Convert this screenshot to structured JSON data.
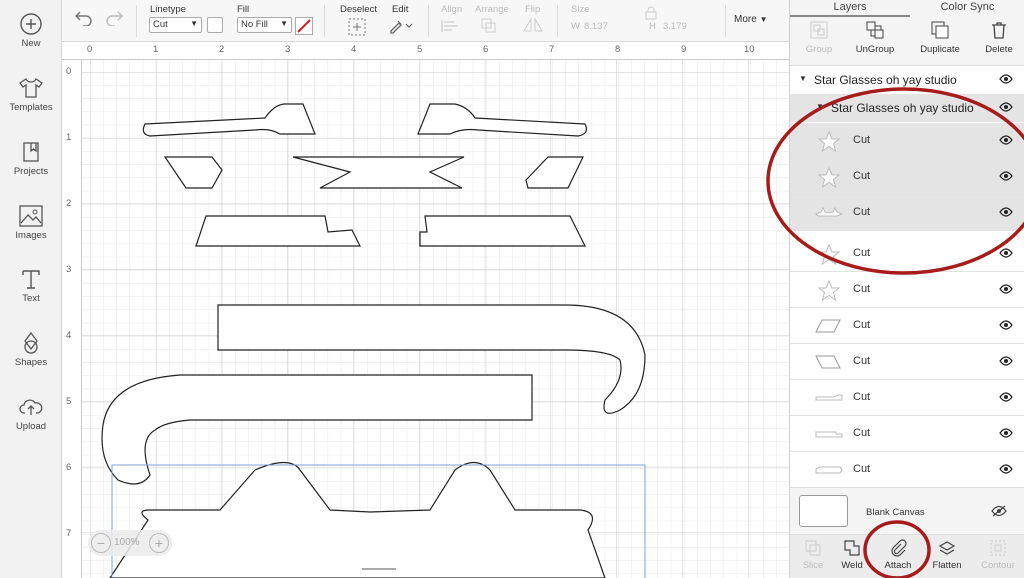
{
  "sidebar": {
    "items": [
      {
        "label": "New",
        "icon": "plus-circle-icon"
      },
      {
        "label": "Templates",
        "icon": "tshirt-icon"
      },
      {
        "label": "Projects",
        "icon": "bookmark-icon"
      },
      {
        "label": "Images",
        "icon": "image-icon"
      },
      {
        "label": "Text",
        "icon": "text-t-icon"
      },
      {
        "label": "Shapes",
        "icon": "shapes-icon"
      },
      {
        "label": "Upload",
        "icon": "cloud-upload-icon"
      }
    ]
  },
  "toolbar": {
    "linetype_label": "Linetype",
    "linetype_value": "Cut",
    "fill_label": "Fill",
    "fill_value": "No Fill",
    "deselect_label": "Deselect",
    "edit_label": "Edit",
    "align_label": "Align",
    "arrange_label": "Arrange",
    "flip_label": "Flip",
    "size_label": "Size",
    "size_w_label": "W",
    "size_w_value": "8.137",
    "size_h_label": "H",
    "size_h_value": "3.179",
    "more_label": "More"
  },
  "ruler": {
    "top": [
      "0",
      "1",
      "2",
      "3",
      "4",
      "5",
      "6",
      "7",
      "8",
      "9",
      "10"
    ],
    "left": [
      "0",
      "1",
      "2",
      "3",
      "4",
      "5",
      "6",
      "7"
    ]
  },
  "zoom": {
    "minus": "−",
    "value": "100%",
    "plus": "+"
  },
  "panel": {
    "tabs": [
      "Layers",
      "Color Sync"
    ],
    "actions": [
      {
        "label": "Group",
        "enabled": false
      },
      {
        "label": "UnGroup",
        "enabled": true
      },
      {
        "label": "Duplicate",
        "enabled": true
      },
      {
        "label": "Delete",
        "enabled": true
      }
    ],
    "group_outer": "Star Glasses oh yay studio",
    "group_inner": "Star Glasses oh yay studio",
    "layers": [
      {
        "name": "Cut",
        "shape": "star",
        "selected": true
      },
      {
        "name": "Cut",
        "shape": "star",
        "selected": true
      },
      {
        "name": "Cut",
        "shape": "stars-pair",
        "selected": true
      },
      {
        "name": "Cut",
        "shape": "star",
        "selected": false
      },
      {
        "name": "Cut",
        "shape": "star",
        "selected": false
      },
      {
        "name": "Cut",
        "shape": "parallelogram",
        "selected": false
      },
      {
        "name": "Cut",
        "shape": "parallelogram-rev",
        "selected": false
      },
      {
        "name": "Cut",
        "shape": "bar",
        "selected": false
      },
      {
        "name": "Cut",
        "shape": "bar",
        "selected": false
      },
      {
        "name": "Cut",
        "shape": "bar",
        "selected": false
      }
    ],
    "blank_canvas_label": "Blank Canvas",
    "bottom_actions": [
      {
        "label": "Slice",
        "enabled": false
      },
      {
        "label": "Weld",
        "enabled": true
      },
      {
        "label": "Attach",
        "enabled": true
      },
      {
        "label": "Flatten",
        "enabled": true
      },
      {
        "label": "Contour",
        "enabled": false
      }
    ]
  },
  "colors": {
    "annotation": "#a61c1c",
    "selection_box": "#7ea6d6",
    "sidebar_bg": "#f2f2f2"
  }
}
